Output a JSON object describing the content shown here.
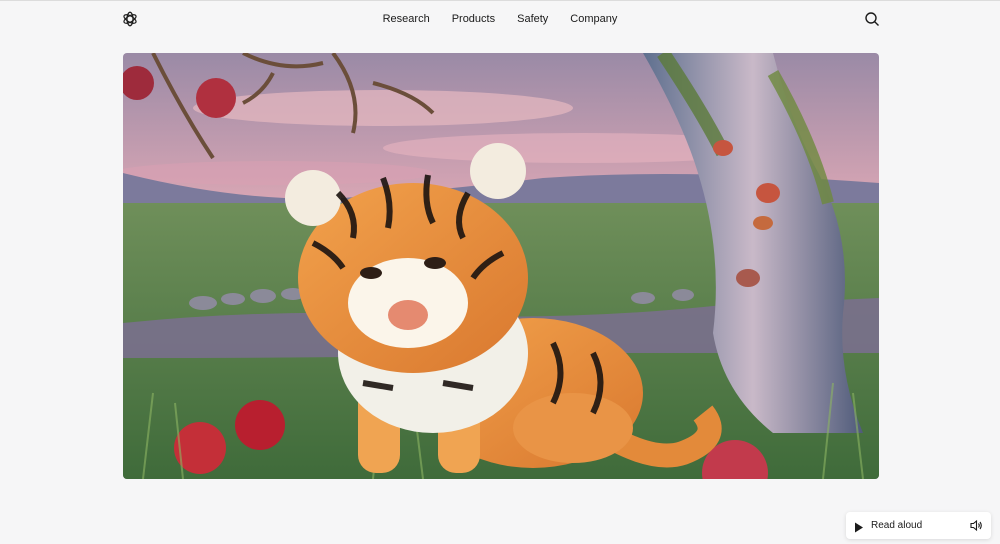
{
  "nav": {
    "logo_icon": "openai-logo-icon",
    "items": [
      {
        "label": "Research"
      },
      {
        "label": "Products"
      },
      {
        "label": "Safety"
      },
      {
        "label": "Company"
      }
    ],
    "search_icon": "search-icon"
  },
  "hero": {
    "image_subject": "tiger cub sitting in grass beside a stream under an apple tree at dusk"
  },
  "reader": {
    "label": "Read aloud",
    "play_icon": "play-icon",
    "speaker_icon": "speaker-icon"
  }
}
